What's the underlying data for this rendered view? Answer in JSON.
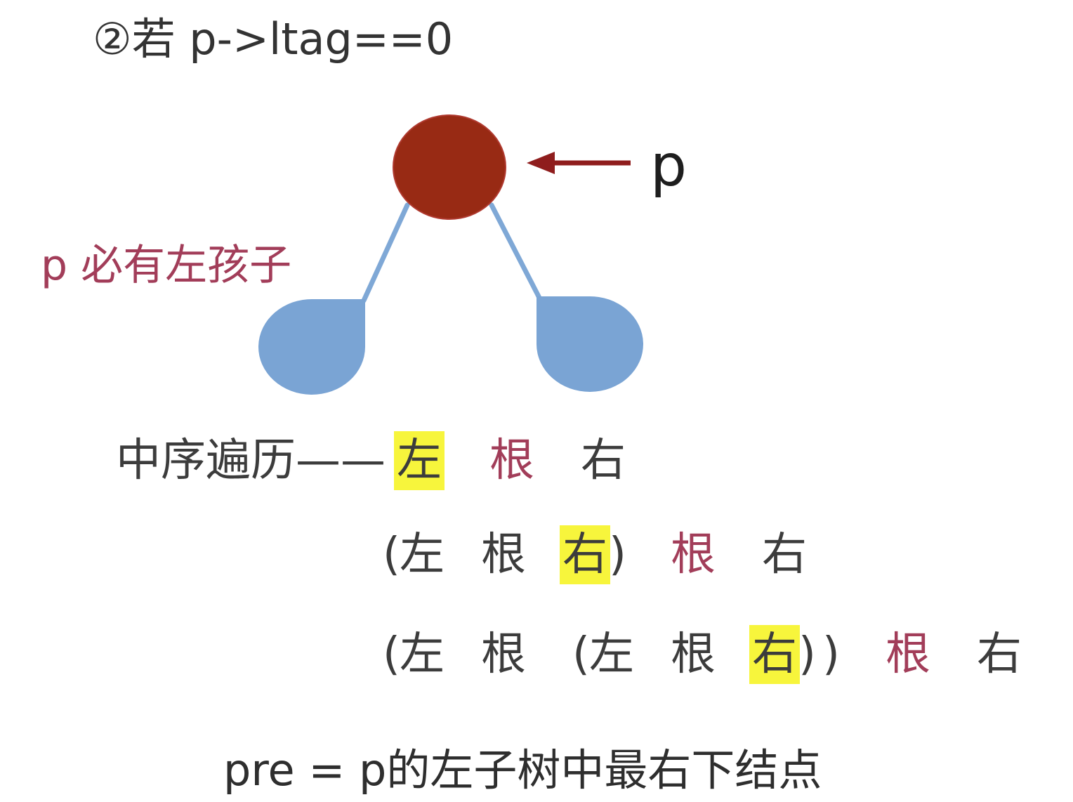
{
  "condition": "②若 p->ltag==0",
  "pointer_label": "p",
  "left_child_note": "p 必有左孩子",
  "traversal": {
    "row1": [
      "中序遍历——",
      "左",
      "根",
      "右"
    ],
    "row2": [
      "(",
      "左",
      "根",
      "右",
      ")",
      "根",
      "右"
    ],
    "row3": [
      "(",
      "左",
      "根",
      "(",
      "左",
      "根",
      "右",
      ")",
      ")",
      "根",
      "右"
    ]
  },
  "conclusion": "pre = p的左子树中最右下结点",
  "colors": {
    "root_node": "#982a14",
    "pointer_arrow": "#8f1d1d",
    "edges": "#7fa8d6",
    "child_subtrees": "#7aa4d4",
    "highlight": "#f7f53c",
    "root_text": "#a23d59"
  }
}
